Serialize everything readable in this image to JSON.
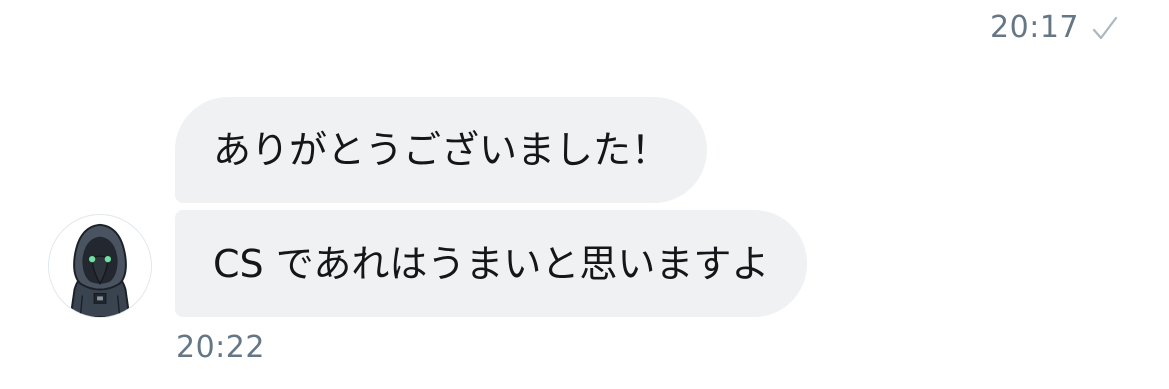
{
  "conversation": {
    "sent": {
      "timestamp": "20:17",
      "status_icon": "checkmark-icon"
    },
    "received": {
      "messages": [
        {
          "text": "ありがとうございました！"
        },
        {
          "text": "CS であれはうまいと思いますよ"
        }
      ],
      "timestamp": "20:22",
      "avatar_icon": "hooded-plague-doctor-avatar"
    }
  },
  "colors": {
    "bubble_background": "#eff1f3",
    "text": "#14171a",
    "meta_text": "#657786",
    "check": "#aab8c2"
  }
}
